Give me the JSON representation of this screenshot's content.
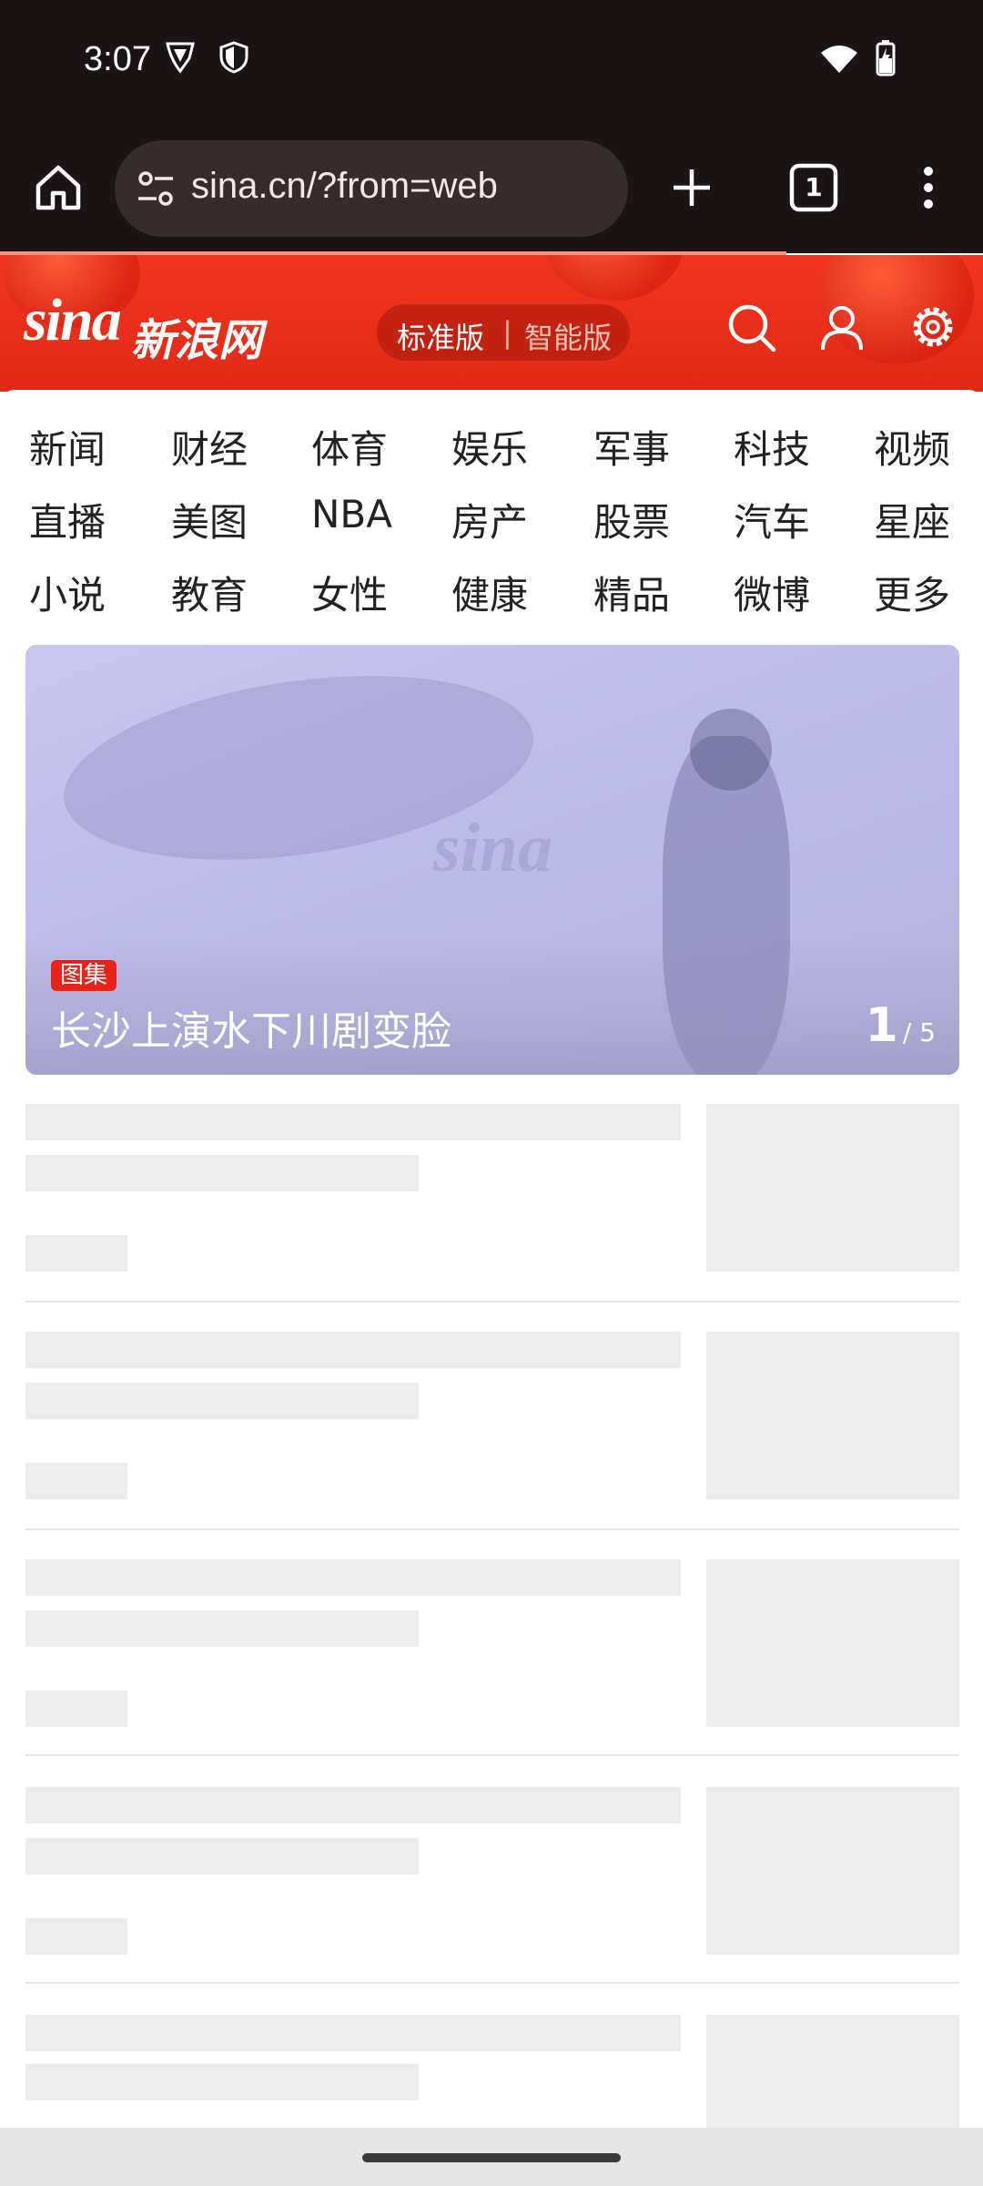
{
  "status_bar": {
    "time": "3:07",
    "icons": [
      "vpn-shield-icon",
      "shield-icon",
      "wifi-icon",
      "battery-charging-icon"
    ]
  },
  "browser": {
    "url": "sina.cn/?from=web",
    "tab_count": "1",
    "icons": [
      "home-icon",
      "site-settings-icon",
      "new-tab-icon",
      "tabs-icon",
      "more-menu-icon"
    ]
  },
  "header": {
    "logo_text": "sina",
    "logo_cn": "新浪网",
    "version_standard": "标准版",
    "version_separator": "|",
    "version_smart": "智能版",
    "icons": [
      "search-icon",
      "user-icon",
      "settings-icon"
    ],
    "colors": {
      "brand": "#e8231a"
    }
  },
  "nav": {
    "rows": [
      [
        "新闻",
        "财经",
        "体育",
        "娱乐",
        "军事",
        "科技",
        "视频"
      ],
      [
        "直播",
        "美图",
        "NBA",
        "房产",
        "股票",
        "汽车",
        "星座"
      ],
      [
        "小说",
        "教育",
        "女性",
        "健康",
        "精品",
        "微博",
        "更多"
      ]
    ]
  },
  "hero": {
    "tag": "图集",
    "title": "长沙上演水下川剧变脸",
    "current": "1",
    "total": "/ 5",
    "watermark": "sina"
  },
  "feed": {
    "loading": true,
    "placeholder_count": 5
  }
}
